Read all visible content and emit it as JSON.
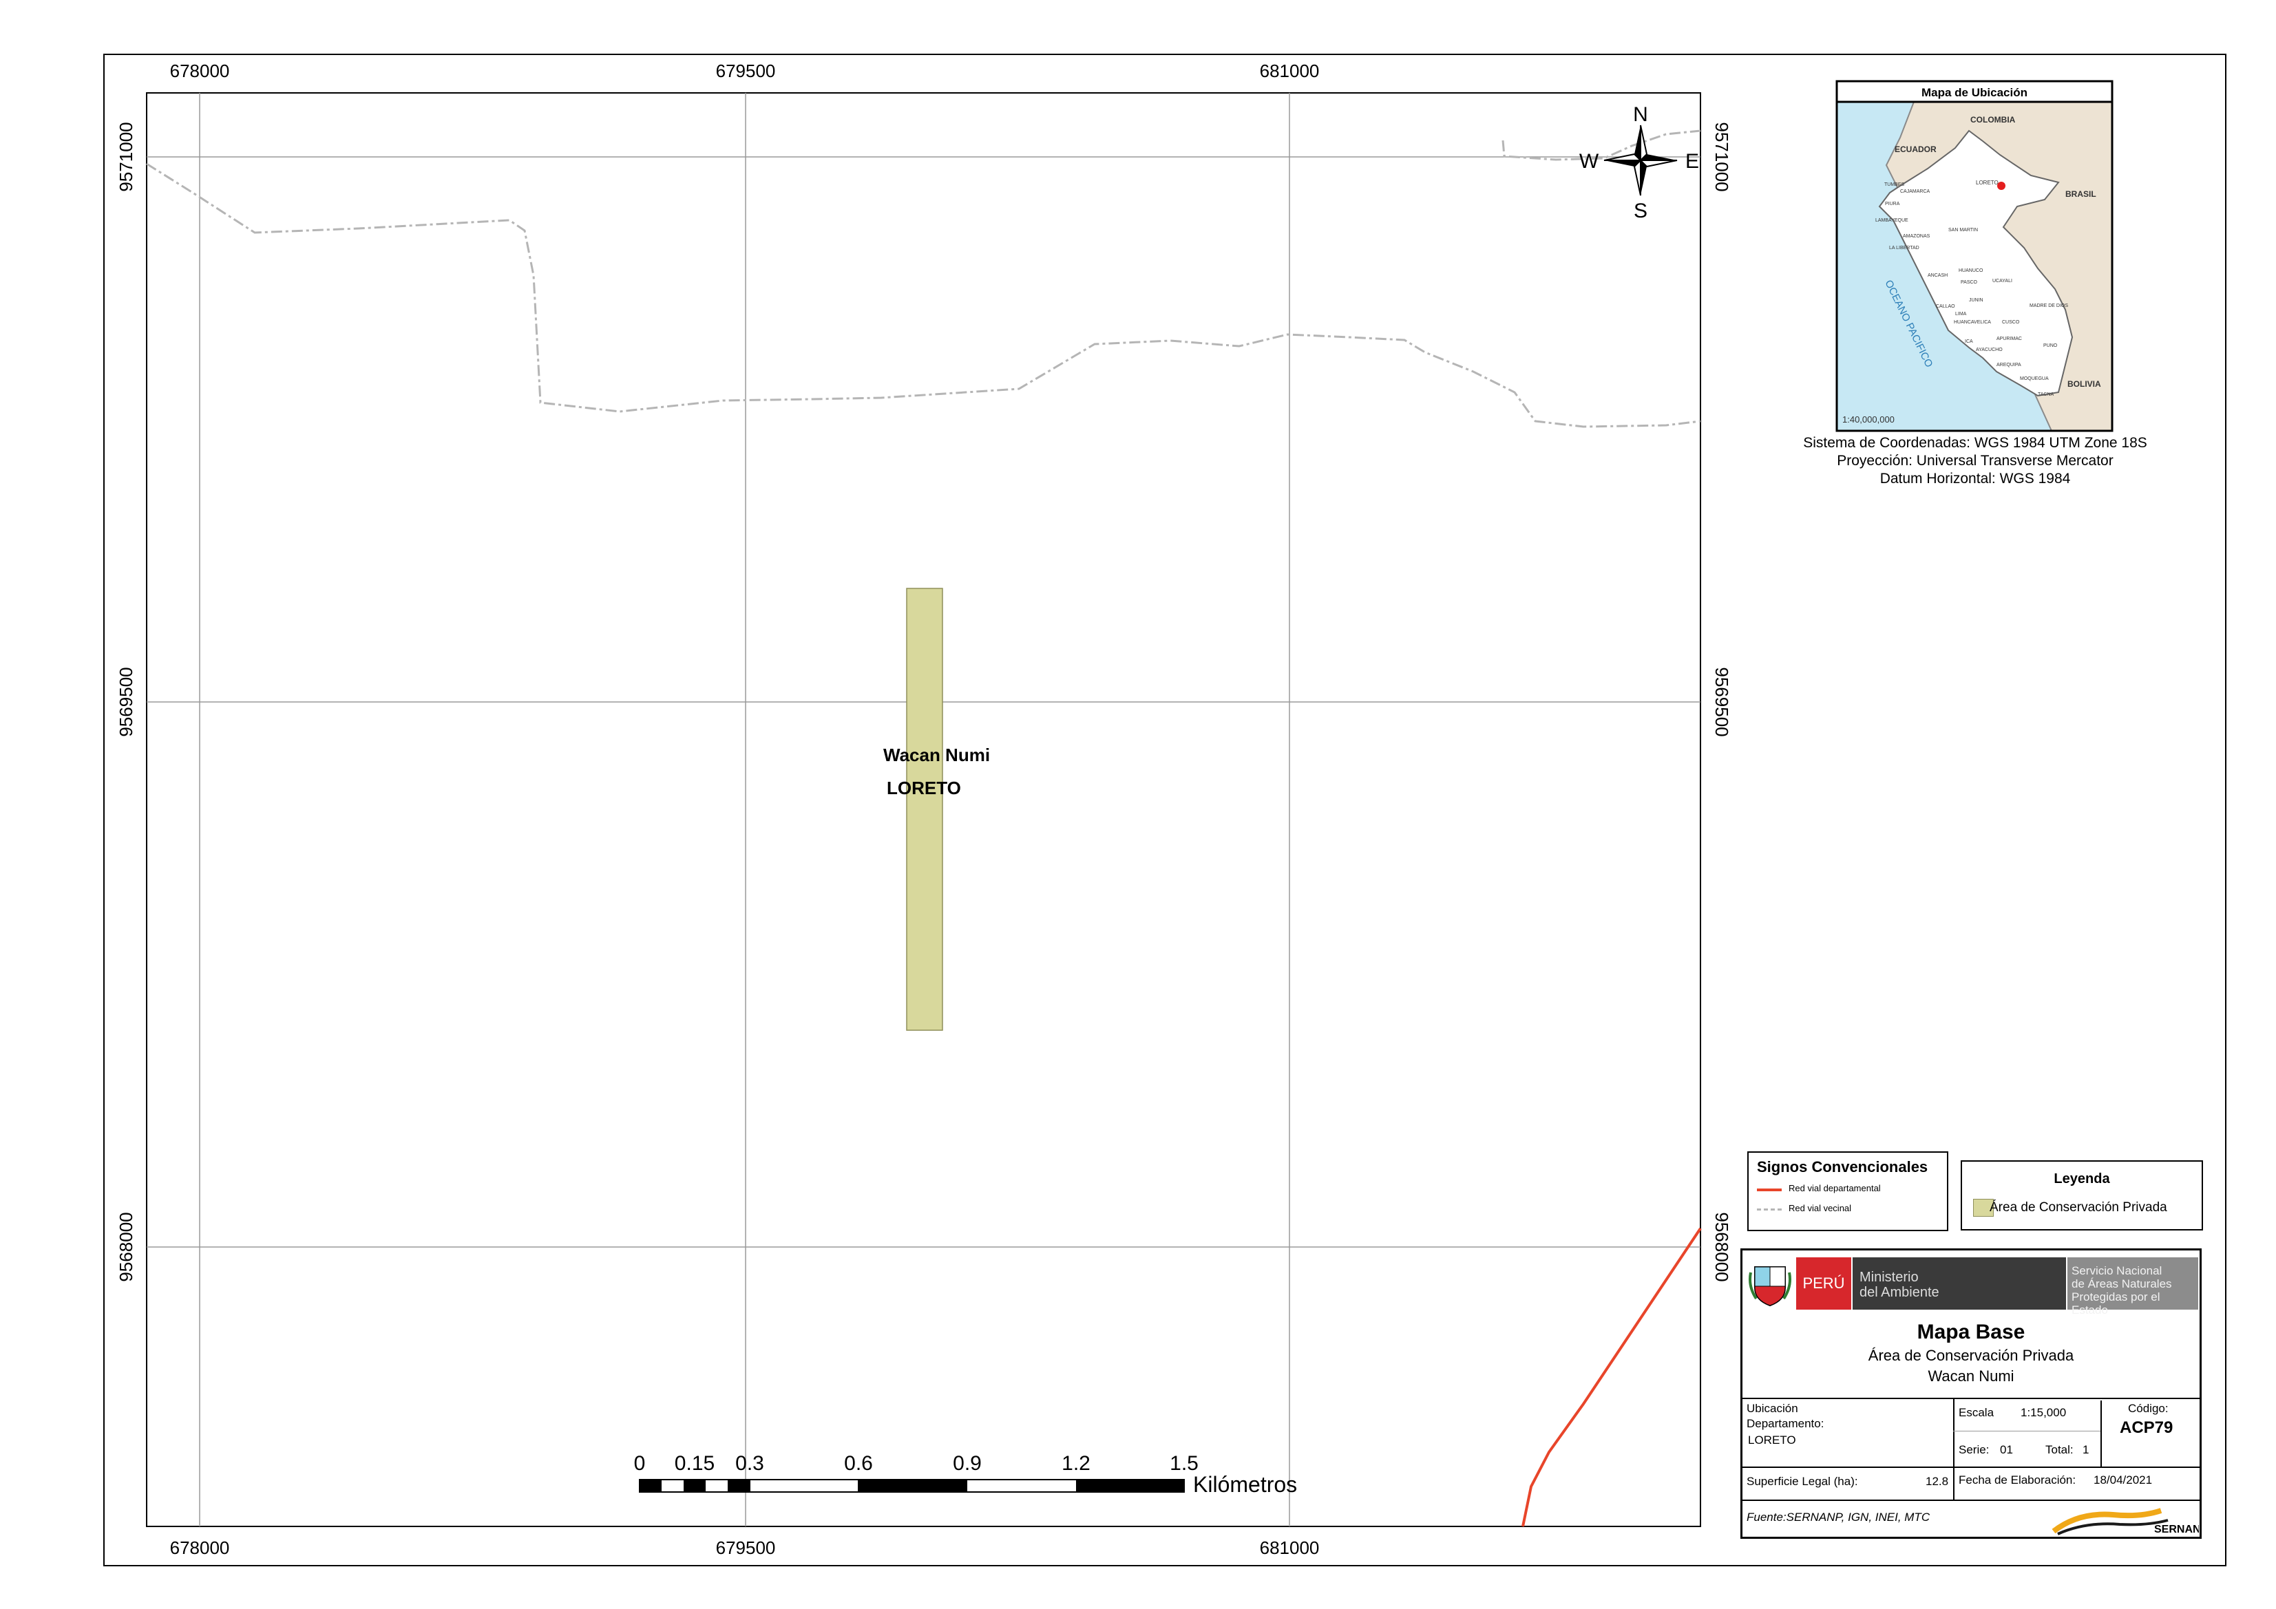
{
  "map": {
    "grid": {
      "x_labels": [
        "678000",
        "679500",
        "681000"
      ],
      "y_labels": [
        "9571000",
        "9569500",
        "9568000"
      ]
    },
    "feature": {
      "name": "Wacan Numi",
      "region": "LORETO",
      "fill_color": "#d8d89c"
    },
    "north_arrow": {
      "n": "N",
      "s": "S",
      "e": "E",
      "w": "W"
    },
    "scale_bar": {
      "ticks": [
        "0",
        "0.15",
        "0.3",
        "0.6",
        "0.9",
        "1.2",
        "1.5"
      ],
      "unit": "Kilómetros"
    },
    "colors": {
      "red_vial_departamental": "#e8452a",
      "red_vial_vecinal": "#b5b5b5"
    }
  },
  "inset": {
    "title": "Mapa de Ubicación",
    "countries": [
      "COLOMBIA",
      "ECUADOR",
      "BRASIL",
      "BOLIVIA"
    ],
    "ocean": "OCEANO PACIFICO",
    "highlight": "LORETO",
    "departments": [
      "TUMBES",
      "PIURA",
      "LAMBAYEQUE",
      "CAJAMARCA",
      "LA LIBERTAD",
      "SAN MARTIN",
      "AMAZONAS",
      "HUANUCO",
      "PASCO",
      "ANCASH",
      "UCAYALI",
      "JUNIN",
      "LIMA",
      "CALLAO",
      "HUANCAVELICA",
      "CUSCO",
      "MADRE DE DIOS",
      "ICA",
      "APURIMAC",
      "AYACUCHO",
      "PUNO",
      "AREQUIPA",
      "MOQUEGUA",
      "TACNA"
    ],
    "scale": "1:40,000,000"
  },
  "coord_system": {
    "line1": "Sistema de Coordenadas: WGS 1984 UTM Zone 18S",
    "line2": "Proyección: Universal Transverse Mercator",
    "line3": "Datum Horizontal: WGS 1984"
  },
  "signos": {
    "title": "Signos Convencionales",
    "items": [
      "Red vial departamental",
      "Red vial vecinal"
    ]
  },
  "leyenda": {
    "title": "Leyenda",
    "item": "Área de Conservación Privada"
  },
  "title_block": {
    "peru": "PERÚ",
    "ministerio": [
      "Ministerio",
      "del Ambiente"
    ],
    "servicio": [
      "Servicio Nacional",
      "de Áreas Naturales",
      "Protegidas por el Estado"
    ],
    "title": "Mapa Base",
    "subtitle": "Área de Conservación Privada",
    "subtitle2": "Wacan Numi",
    "ubicacion_label": "Ubicación",
    "departamento_label": "Departamento:",
    "departamento_value": "LORETO",
    "escala_label": "Escala",
    "escala_value": "1:15,000",
    "serie_label": "Serie:",
    "serie_value": "01",
    "total_label": "Total:",
    "total_value": "1",
    "codigo_label": "Código:",
    "codigo_value": "ACP79",
    "superficie_label": "Superficie Legal (ha):",
    "superficie_value": "12.8",
    "fecha_label": "Fecha de Elaboración:",
    "fecha_value": "18/04/2021",
    "fuente": "Fuente:SERNANP, IGN, INEI, MTC",
    "logo": "SERNANP"
  }
}
